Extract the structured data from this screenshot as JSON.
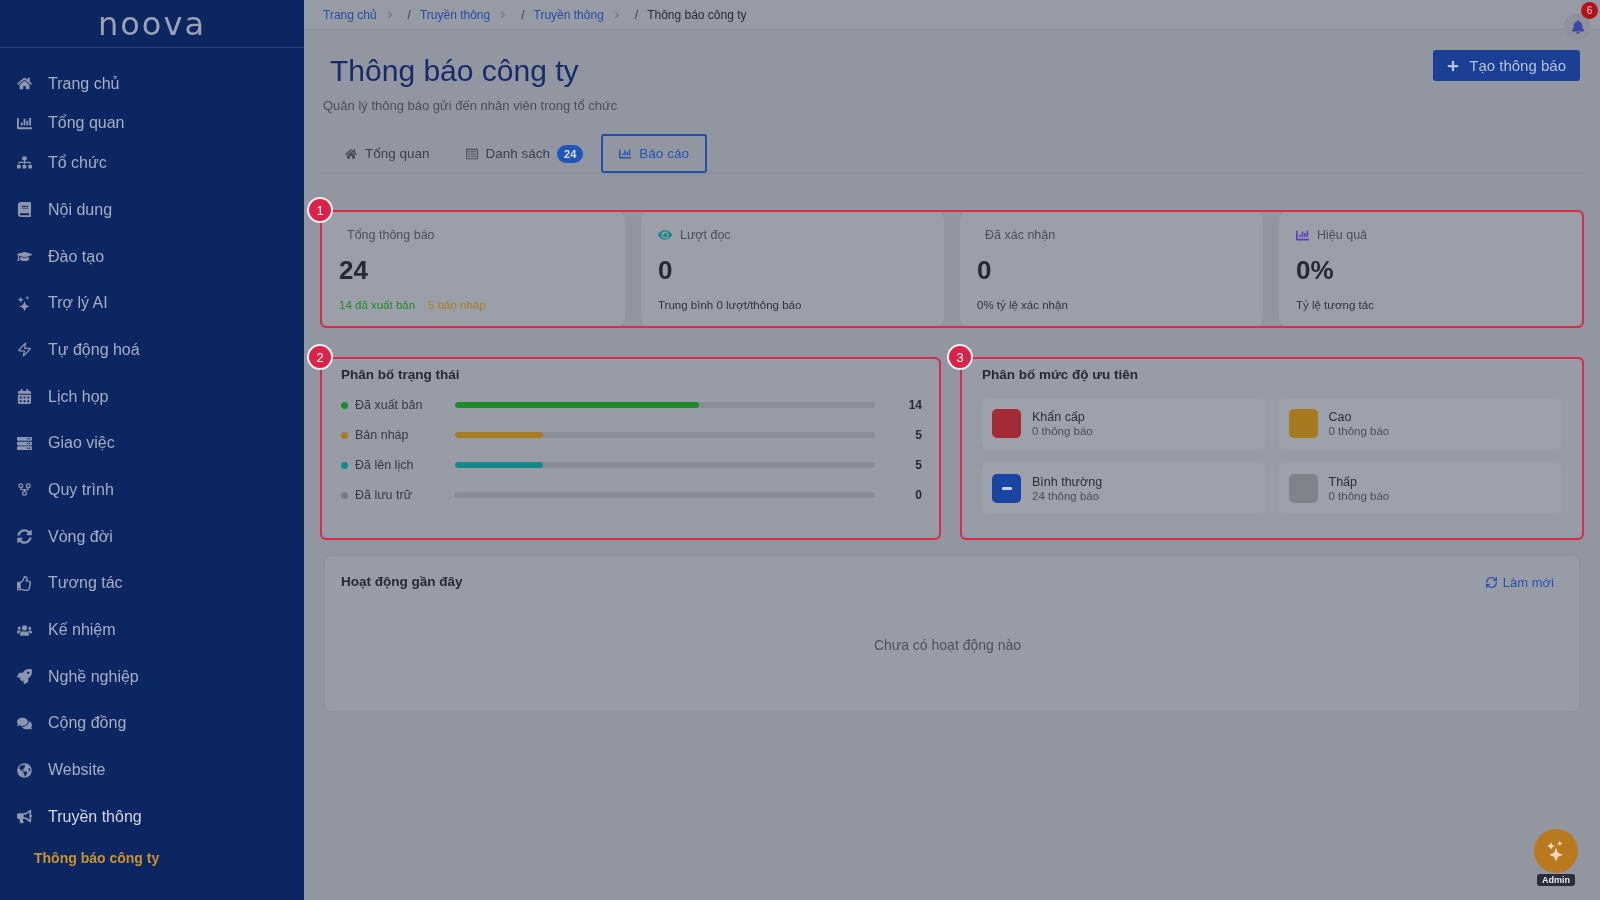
{
  "sidebar": {
    "logo": "noova",
    "items": [
      {
        "label": "Trang chủ",
        "expanded": false
      },
      {
        "label": "Tổng quan",
        "expanded": false
      },
      {
        "label": "Tổ chức",
        "expanded": false
      },
      {
        "label": "Nội dung",
        "expanded": false
      },
      {
        "label": "Đào tạo",
        "expanded": false
      },
      {
        "label": "Trợ lý AI",
        "expanded": false
      },
      {
        "label": "Tự động hoá",
        "expanded": false
      },
      {
        "label": "Lịch họp",
        "expanded": false
      },
      {
        "label": "Giao việc",
        "expanded": false
      },
      {
        "label": "Quy trình",
        "expanded": false
      },
      {
        "label": "Vòng đời",
        "expanded": false
      },
      {
        "label": "Tương tác",
        "expanded": false
      },
      {
        "label": "Kế nhiệm",
        "expanded": false
      },
      {
        "label": "Nghề nghiệp",
        "expanded": false
      },
      {
        "label": "Cộng đồng",
        "expanded": false
      },
      {
        "label": "Website",
        "expanded": false
      },
      {
        "label": "Truyền thông",
        "expanded": true,
        "children": [
          {
            "label": "Thông báo công ty",
            "selected": true
          }
        ]
      }
    ]
  },
  "breadcrumb": [
    {
      "label": "Trang chủ",
      "current": false
    },
    {
      "prefix": "/",
      "label": "Truyền thông",
      "current": false
    },
    {
      "prefix": "/",
      "label": "Truyền thông",
      "current": false
    },
    {
      "prefix": "/",
      "label": "Thông báo công ty",
      "current": true
    }
  ],
  "notifications": {
    "count": "6"
  },
  "page": {
    "title": "Thông báo công ty",
    "subtitle": "Quản lý thông báo gửi đến nhân viên trong tổ chức",
    "create_button": "Tạo thông báo"
  },
  "tabs": [
    {
      "label": "Tổng quan",
      "selected": false
    },
    {
      "label": "Danh sách",
      "badge": "24",
      "selected": false
    },
    {
      "label": "Báo cáo",
      "selected": true
    }
  ],
  "stats": {
    "marker": "1",
    "cards": [
      {
        "kind": "plain",
        "label": "Tổng thông báo",
        "value": "24",
        "notes": [
          {
            "text": "14 đã xuất bản",
            "color": "#1e8a2c"
          },
          {
            "text": "5 bản nháp",
            "color": "#a8801f"
          }
        ]
      },
      {
        "kind": "views",
        "label": "Lượt đọc",
        "value": "0",
        "notes": [
          {
            "text": "Trung bình 0 lượt/thông báo"
          }
        ]
      },
      {
        "kind": "plain",
        "label": "Đã xác nhận",
        "value": "0",
        "notes": [
          {
            "text": "0% tỷ lệ xác nhận"
          }
        ]
      },
      {
        "kind": "chart",
        "label": "Hiệu quả",
        "value": "0%",
        "notes": [
          {
            "text": "Tỷ lệ tương tác"
          }
        ]
      }
    ]
  },
  "status_distribution": {
    "marker": "2",
    "title": "Phân bố trạng thái",
    "rows": [
      {
        "label": "Đã xuất bản",
        "value": "14",
        "level": 0.58,
        "color": "#1e8a2c"
      },
      {
        "label": "Bản nháp",
        "value": "5",
        "level": 0.21,
        "color": "#a87c22"
      },
      {
        "label": "Đã lên lịch",
        "value": "5",
        "level": 0.21,
        "color": "#138a87"
      },
      {
        "label": "Đã lưu trữ",
        "value": "0",
        "level": 0,
        "color": "#787c86"
      }
    ]
  },
  "priority_distribution": {
    "marker": "3",
    "title": "Phân bố mức độ ưu tiên",
    "items": [
      {
        "kind": "plain",
        "label": "Khẩn cấp",
        "count": "0 thông báo",
        "color": "#a32b36"
      },
      {
        "kind": "plain",
        "label": "Cao",
        "count": "0 thông báo",
        "color": "#a67b1f"
      },
      {
        "kind": "minus",
        "label": "Bình thường",
        "count": "24 thông báo",
        "color": "#1a44a1"
      },
      {
        "kind": "plain",
        "label": "Thấp",
        "count": "0 thông báo",
        "color": "#7f838c"
      }
    ]
  },
  "recent_activity": {
    "title": "Hoạt động gần đây",
    "refresh": "Làm mới",
    "empty": "Chưa có hoạt động nào"
  },
  "assistant": {
    "tag": "Admin"
  }
}
